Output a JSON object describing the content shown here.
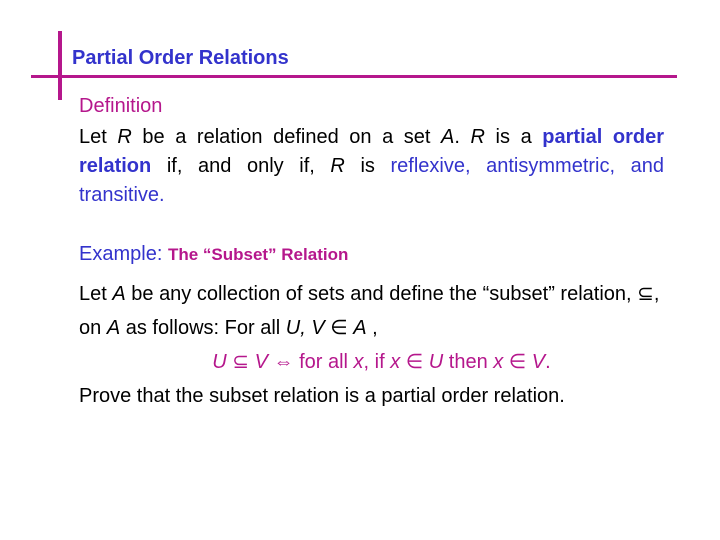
{
  "slide": {
    "title": "Partial Order Relations",
    "definition": {
      "heading": "Definition",
      "p1": "Let ",
      "var_R1": "R",
      "p2": " be a relation defined on a set ",
      "var_A1": "A",
      "p3": ". ",
      "var_R2": "R",
      "p4": " is a ",
      "term": "partial order relation",
      "p5": " if, and only if, ",
      "var_R3": "R",
      "p6": " is ",
      "properties": "reflexive, antisymmetric, and transitive."
    },
    "example": {
      "label": "Example: ",
      "subtitle": "The “Subset” Relation",
      "l1a": "Let ",
      "l1_var_A": "A",
      "l1b": " be any collection of sets and define the “subset” relation, ⊆, on ",
      "l1_var_A2": "A",
      "l1c": " as follows: For all ",
      "l1_vars": "U, V",
      "l1d": " ∈ ",
      "l1_var_A3": "A",
      "l1e": " ,",
      "f_U": "U",
      "f_sub": " ⊆ ",
      "f_V": "V",
      "f_iff": " ⇔ for all ",
      "f_x1": "x",
      "f_if": ", if ",
      "f_x2": "x",
      "f_in1": " ∈ ",
      "f_U2": "U",
      "f_then": " then ",
      "f_x3": "x",
      "f_in2": " ∈ ",
      "f_V2": "V",
      "f_end": ".",
      "prove": "Prove that the subset relation is a partial order relation."
    }
  }
}
